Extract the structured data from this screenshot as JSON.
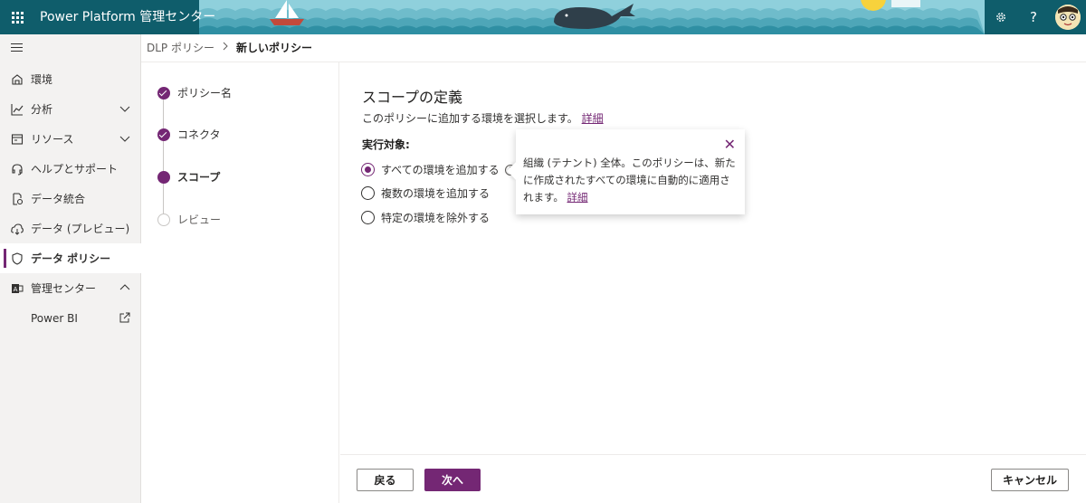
{
  "header": {
    "app_title": "Power Platform 管理センター",
    "settings_icon": "gear-icon",
    "help_label": "?",
    "colors": {
      "bar": "#0f5d6b",
      "sky": "#8fd0dc",
      "whale": "#2f3f4a"
    }
  },
  "sidebar": {
    "items": [
      {
        "label": "環境",
        "icon": "environment-icon"
      },
      {
        "label": "分析",
        "icon": "analytics-icon"
      },
      {
        "label": "リソース",
        "icon": "resources-icon"
      },
      {
        "label": "ヘルプとサポート",
        "icon": "headset-icon"
      },
      {
        "label": "データ統合",
        "icon": "data-integration-icon"
      },
      {
        "label": "データ (プレビュー)",
        "icon": "cloud-data-icon"
      },
      {
        "label": "データ ポリシー",
        "icon": "shield-icon"
      },
      {
        "label": "管理センター",
        "icon": "admin-center-icon"
      },
      {
        "label": "Power BI",
        "icon": "external-link-icon"
      }
    ]
  },
  "breadcrumb": {
    "parent": "DLP ポリシー",
    "current": "新しいポリシー"
  },
  "steps": [
    {
      "label": "ポリシー名",
      "state": "done"
    },
    {
      "label": "コネクタ",
      "state": "done"
    },
    {
      "label": "スコープ",
      "state": "current"
    },
    {
      "label": "レビュー",
      "state": "upcoming"
    }
  ],
  "main": {
    "title": "スコープの定義",
    "description": "このポリシーに追加する環境を選択します。",
    "details_link": "詳細",
    "field_label": "実行対象:",
    "options": [
      {
        "label": "すべての環境を追加する",
        "selected": true
      },
      {
        "label": "複数の環境を追加する",
        "selected": false
      },
      {
        "label": "特定の環境を除外する",
        "selected": false
      }
    ]
  },
  "callout": {
    "text": "組織 (テナント) 全体。このポリシーは、新たに作成されたすべての環境に自動的に適用されます。",
    "link": "詳細"
  },
  "footer": {
    "back_label": "戻る",
    "next_label": "次へ",
    "cancel_label": "キャンセル"
  },
  "accent": "#742774"
}
